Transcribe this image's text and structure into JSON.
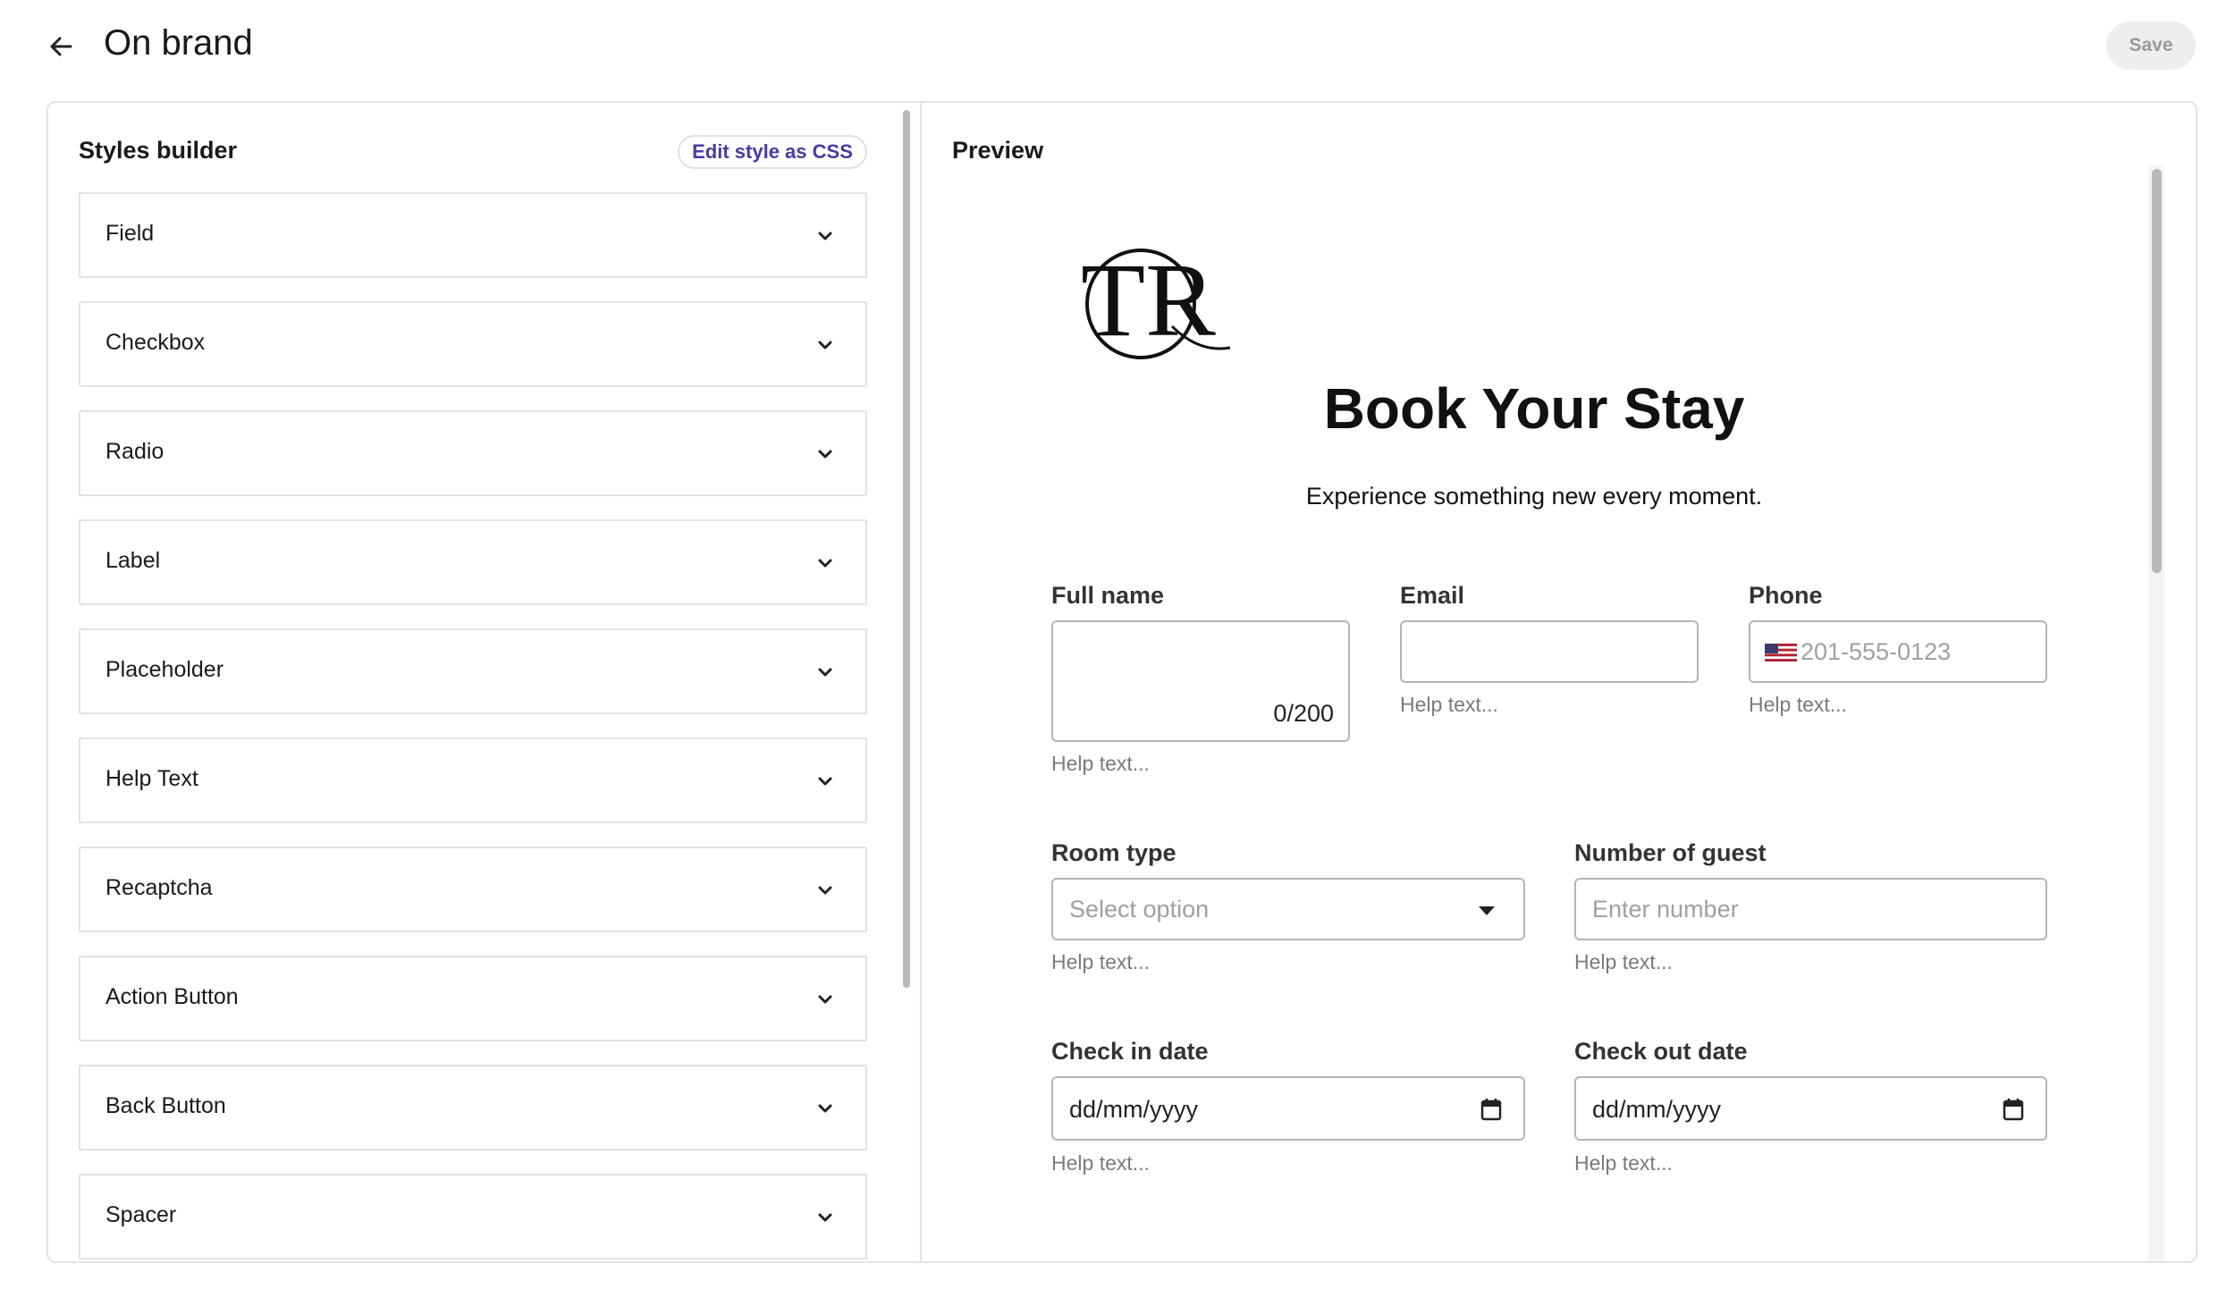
{
  "header": {
    "title": "On brand",
    "save_label": "Save"
  },
  "styles_builder": {
    "title": "Styles builder",
    "edit_css_label": "Edit style as CSS",
    "items": [
      {
        "label": "Field"
      },
      {
        "label": "Checkbox"
      },
      {
        "label": "Radio"
      },
      {
        "label": "Label"
      },
      {
        "label": "Placeholder"
      },
      {
        "label": "Help Text"
      },
      {
        "label": "Recaptcha"
      },
      {
        "label": "Action Button"
      },
      {
        "label": "Back Button"
      },
      {
        "label": "Spacer"
      }
    ]
  },
  "preview": {
    "title": "Preview",
    "logo_text": "TR",
    "form_title": "Book Your Stay",
    "form_subtitle": "Experience something new every moment.",
    "fields": {
      "full_name": {
        "label": "Full name",
        "counter": "0/200",
        "help": "Help text..."
      },
      "email": {
        "label": "Email",
        "help": "Help text..."
      },
      "phone": {
        "label": "Phone",
        "placeholder": "201-555-0123",
        "help": "Help text..."
      },
      "room_type": {
        "label": "Room type",
        "placeholder": "Select option",
        "help": "Help text..."
      },
      "guests": {
        "label": "Number of guest",
        "placeholder": "Enter number",
        "help": "Help text..."
      },
      "check_in": {
        "label": "Check in date",
        "value": "dd/mm/yyyy",
        "help": "Help text..."
      },
      "check_out": {
        "label": "Check out date",
        "value": "dd/mm/yyyy",
        "help": "Help text..."
      }
    }
  },
  "colors": {
    "accent": "#4b3aa6",
    "border": "#e3e3e3",
    "save_bg": "#eeeeee"
  }
}
